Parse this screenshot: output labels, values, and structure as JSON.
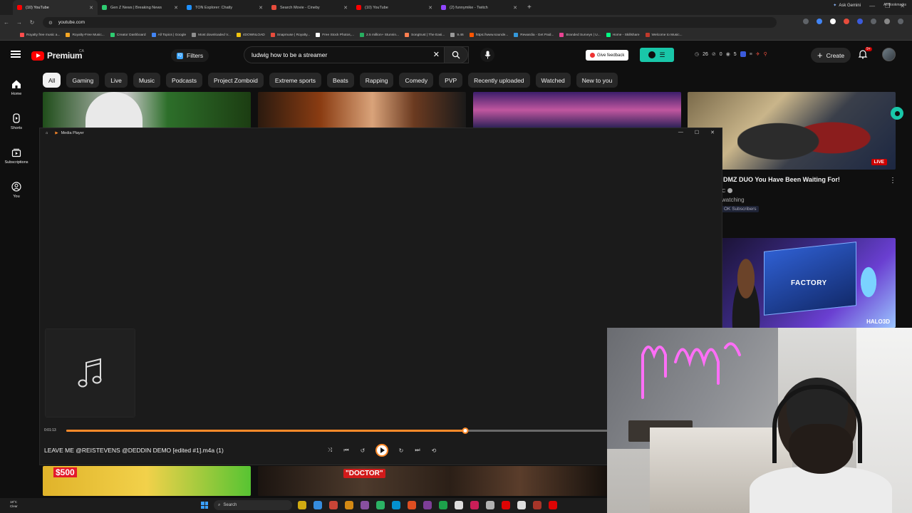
{
  "browser": {
    "tabs": [
      {
        "label": "(10) YouTube",
        "color": "#ff0000",
        "active": true
      },
      {
        "label": "Gen Z News | Breaking News",
        "color": "#2ecc71",
        "active": false
      },
      {
        "label": "TON Explorer: Chatly",
        "color": "#1e90ff",
        "active": false
      },
      {
        "label": "Search Movie - Cineby",
        "color": "#e74c3c",
        "active": false
      },
      {
        "label": "(10) YouTube",
        "color": "#ff0000",
        "active": false
      },
      {
        "label": "(2) funnymike - Twitch",
        "color": "#9146ff",
        "active": false
      }
    ],
    "gemini_label": "Ask Gemini",
    "url": "youtube.com",
    "bookmarks": [
      {
        "label": "Royalty free music a...",
        "color": "#ff4d4d"
      },
      {
        "label": "Royalty-Free Music...",
        "color": "#f5a623"
      },
      {
        "label": "Creator Dashboard",
        "color": "#2ecc71"
      },
      {
        "label": "All Topics | Google",
        "color": "#4285f4"
      },
      {
        "label": "Most downloaded V...",
        "color": "#8e8e8e"
      },
      {
        "label": "4DOWNLOAD",
        "color": "#f1c40f"
      },
      {
        "label": "Snapmuse | Royalty...",
        "color": "#e74c3c"
      },
      {
        "label": "Free Stock Photos,...",
        "color": "#ffffff"
      },
      {
        "label": "2.5 million+ Stunnin...",
        "color": "#27ae60"
      },
      {
        "label": "Songtrust | The Easi...",
        "color": "#ff7f50"
      },
      {
        "label": "9.46",
        "color": "#999999"
      },
      {
        "label": "https://www.sounde...",
        "color": "#ff5500"
      },
      {
        "label": "Rewardia - Get Paid...",
        "color": "#3498db"
      },
      {
        "label": "Branded Surveys | U...",
        "color": "#e84393"
      },
      {
        "label": "Home - Skillshare",
        "color": "#00ff84"
      },
      {
        "label": "Welcome to Music...",
        "color": "#c0392b"
      }
    ],
    "all_bookmarks_label": "All Bookmarks"
  },
  "youtube": {
    "logo_text": "Premium",
    "country": "CA",
    "filters_label": "Filters",
    "filters_icon_text": "IQ",
    "search_value": "ludwig how to be a streamer",
    "feedback_label": "Give feedback",
    "stats": {
      "time": "26",
      "count_a": "0",
      "count_b": "5"
    },
    "create_label": "Create",
    "notification_badge": "9+",
    "chips": [
      "All",
      "Gaming",
      "Live",
      "Music",
      "Podcasts",
      "Project Zomboid",
      "Extreme sports",
      "Beats",
      "Rapping",
      "Comedy",
      "PVP",
      "Recently uploaded",
      "Watched",
      "New to you"
    ],
    "rail": [
      {
        "label": "Home",
        "icon": "home-icon"
      },
      {
        "label": "Shorts",
        "icon": "shorts-icon"
      },
      {
        "label": "Subscriptions",
        "icon": "subscriptions-icon"
      },
      {
        "label": "You",
        "icon": "you-icon"
      }
    ],
    "live_badge": "LIVE",
    "video": {
      "title": "DMZ DUO You Have Been Waiting For!",
      "channel": "C",
      "watching": "watching",
      "subs": "OK Subscribers"
    },
    "ad": {
      "word1": "FACTORY",
      "word2": "HALO3D"
    },
    "bottom_thumbs": {
      "money": "$500",
      "doctor": "\"DOCTOR\""
    }
  },
  "player": {
    "title": "Media Player",
    "time": "0:01:13",
    "progress": 0.7,
    "track": "LEAVE ME @REISTEVENS @DEDDIN DEMO [edited #1].m4a (1)"
  },
  "taskbar": {
    "weather_temp": "18°C",
    "weather_desc": "Clear",
    "search_label": "Search",
    "icons": [
      "#f1c40f",
      "#3aa0ff",
      "#e74c3c",
      "#f39c12",
      "#9b59b6",
      "#2ecc71",
      "#00a4ef",
      "#ff5722",
      "#8e44ad",
      "#1db954",
      "#ffffff",
      "#e91e63",
      "#cccccc",
      "#ff0000",
      "#ffffff",
      "#c0392b",
      "#ff0000"
    ]
  }
}
